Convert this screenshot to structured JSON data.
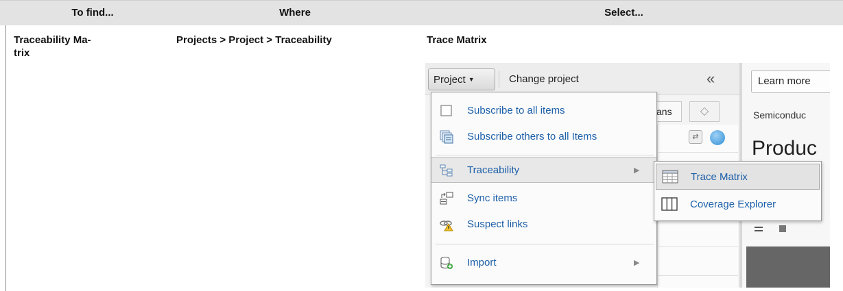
{
  "table": {
    "headers": [
      "To find...",
      "Where",
      "Select..."
    ],
    "row": {
      "to_find_line1": "Traceability Ma-",
      "to_find_line2": "trix",
      "where": "Projects > Project > Traceability",
      "select": "Trace Matrix"
    }
  },
  "screenshot": {
    "project_button": "Project",
    "change_project": "Change project",
    "learn_more": "Learn more",
    "behind_tab": "ans",
    "semiconductor": "Semiconduc",
    "product_heading": "Produc",
    "menu_items": [
      {
        "label": "Subscribe to all items",
        "icon": "checkbox-icon"
      },
      {
        "label": "Subscribe others to all Items",
        "icon": "subscribe-others-icon"
      },
      {
        "label": "Traceability",
        "icon": "traceability-icon",
        "has_submenu": true,
        "highlighted": true
      },
      {
        "label": "Sync items",
        "icon": "sync-items-icon"
      },
      {
        "label": "Suspect links",
        "icon": "suspect-links-icon"
      },
      {
        "label": "Import",
        "icon": "import-icon",
        "has_submenu": true
      }
    ],
    "submenu_items": [
      {
        "label": "Trace Matrix",
        "icon": "trace-matrix-icon",
        "highlighted": true
      },
      {
        "label": "Coverage Explorer",
        "icon": "coverage-explorer-icon"
      }
    ]
  }
}
